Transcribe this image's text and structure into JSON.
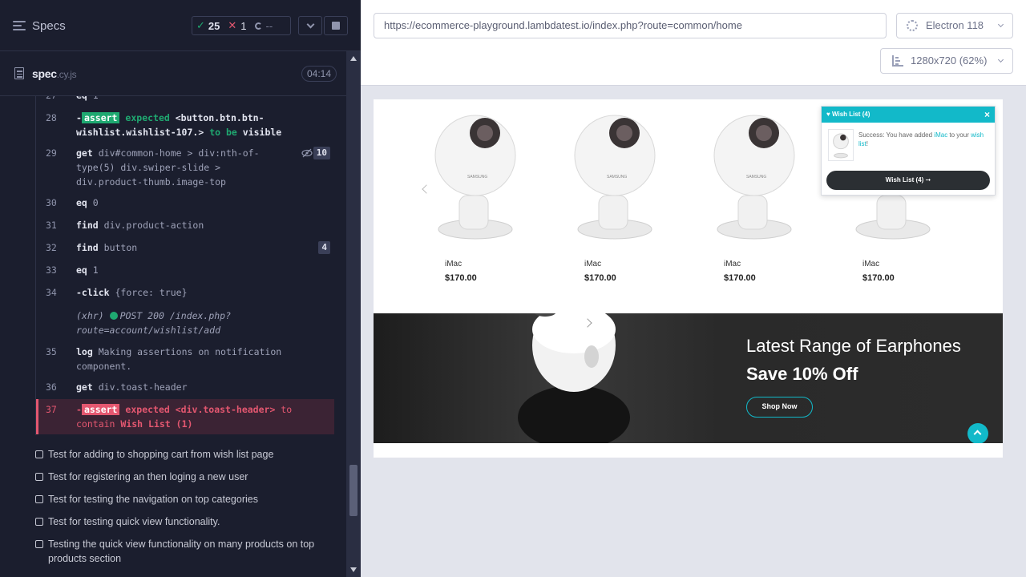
{
  "reporter": {
    "header_title": "Specs",
    "stats": {
      "passed": "25",
      "failed": "1",
      "pending": "--"
    },
    "spec_file": {
      "name": "spec",
      "ext": ".cy.js",
      "duration": "04:14"
    },
    "commands": [
      {
        "num": "27",
        "name": "eq",
        "message": "1"
      },
      {
        "num": "28",
        "prefix": "-",
        "name": "assert",
        "message_parts": [
          "expected",
          "<button.btn.btn-wishlist.wishlist-107.>",
          "to be",
          "visible"
        ]
      },
      {
        "num": "29",
        "name": "get",
        "message": "div#common-home > div:nth-of-type(5) div.swiper-slide > div.product-thumb.image-top",
        "badge": "10"
      },
      {
        "num": "30",
        "name": "eq",
        "message": "0"
      },
      {
        "num": "31",
        "name": "find",
        "message": "div.product-action"
      },
      {
        "num": "32",
        "name": "find",
        "message": "button",
        "badge": "4"
      },
      {
        "num": "33",
        "name": "eq",
        "message": "1"
      },
      {
        "num": "34",
        "name": "-click",
        "message": "{force: true}"
      },
      {
        "num": "",
        "name": "(xhr)",
        "message": "POST 200 /index.php?route=account/wishlist/add"
      },
      {
        "num": "35",
        "name": "log",
        "message": "Making assertions on notification component."
      },
      {
        "num": "36",
        "name": "get",
        "message": "div.toast-header"
      },
      {
        "num": "37",
        "prefix": "-",
        "name": "assert",
        "message_parts": [
          "expected",
          "<div.toast-header>",
          "to contain",
          "Wish List (1)"
        ]
      }
    ],
    "tests": [
      "Test for adding to shopping cart from wish list page",
      "Test for registering an then loging a new user",
      "Test for testing the navigation on top categories",
      "Test for testing quick view functionality.",
      "Testing the quick view functionality on many products on top products section"
    ]
  },
  "aut": {
    "url": "https://ecommerce-playground.lambdatest.io/index.php?route=common/home",
    "browser": "Electron 118",
    "viewport": "1280x720 (62%)",
    "products": [
      {
        "name": "iMac",
        "price": "$170.00"
      },
      {
        "name": "iMac",
        "price": "$170.00"
      },
      {
        "name": "iMac",
        "price": "$170.00"
      },
      {
        "name": "iMac",
        "price": "$170.00"
      }
    ],
    "toast": {
      "header": "Wish List (4)",
      "close": "×",
      "message_prefix": "Success: You have added ",
      "message_link1": "iMac",
      "message_mid": " to your ",
      "message_link2": "wish list",
      "message_suffix": "!",
      "button": "Wish List (4) ➞"
    },
    "banner": {
      "title": "Latest Range of Earphones",
      "subtitle": "Save 10% Off",
      "button": "Shop Now"
    }
  },
  "colors": {
    "accent": "#12b9c9",
    "pass": "#1fa971",
    "fail": "#e45770",
    "reporter_bg": "#1b1e2e"
  }
}
